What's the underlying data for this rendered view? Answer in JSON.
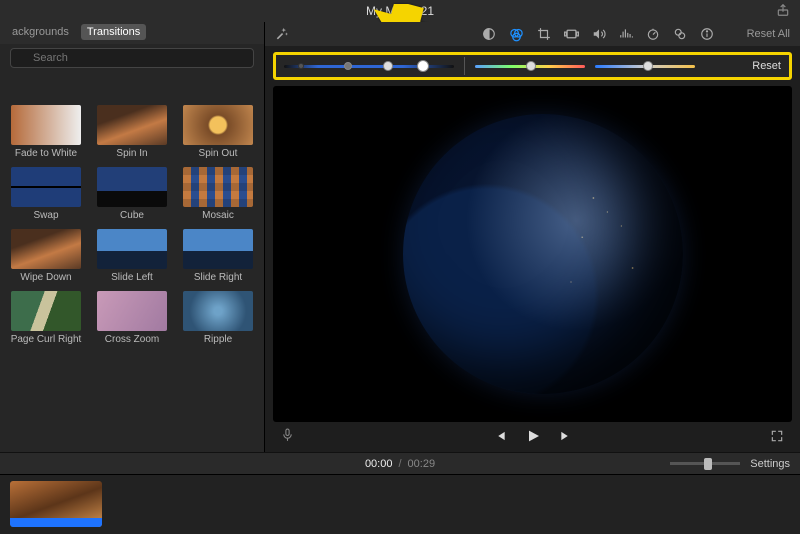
{
  "title": "My Movie 21",
  "sidebar": {
    "tabs": {
      "backgrounds": "ackgrounds",
      "transitions": "Transitions"
    },
    "search_placeholder": "Search",
    "items": [
      {
        "label": "Fade to White",
        "thumb": "th-fade"
      },
      {
        "label": "Spin In",
        "thumb": "th-forest"
      },
      {
        "label": "Spin Out",
        "thumb": "th-box"
      },
      {
        "label": "Swap",
        "thumb": "th-swap"
      },
      {
        "label": "Cube",
        "thumb": "th-sky2"
      },
      {
        "label": "Mosaic",
        "thumb": "th-mosaic"
      },
      {
        "label": "Wipe Down",
        "thumb": "th-forest"
      },
      {
        "label": "Slide Left",
        "thumb": "th-mtn"
      },
      {
        "label": "Slide Right",
        "thumb": "th-mtn"
      },
      {
        "label": "Page Curl Right",
        "thumb": "th-curl"
      },
      {
        "label": "Cross Zoom",
        "thumb": "th-pink"
      },
      {
        "label": "Ripple",
        "thumb": "th-ripple"
      }
    ]
  },
  "toolbar": {
    "reset_all": "Reset All",
    "icons": [
      "wand-icon",
      "color-balance-icon",
      "color-correction-icon",
      "crop-icon",
      "stabilize-icon",
      "volume-icon",
      "noise-icon",
      "speed-icon",
      "filters-icon",
      "info-icon"
    ]
  },
  "color_panel": {
    "reset": "Reset"
  },
  "time": {
    "current": "00:00",
    "sep": "/",
    "total": "00:29"
  },
  "settings_label": "Settings"
}
